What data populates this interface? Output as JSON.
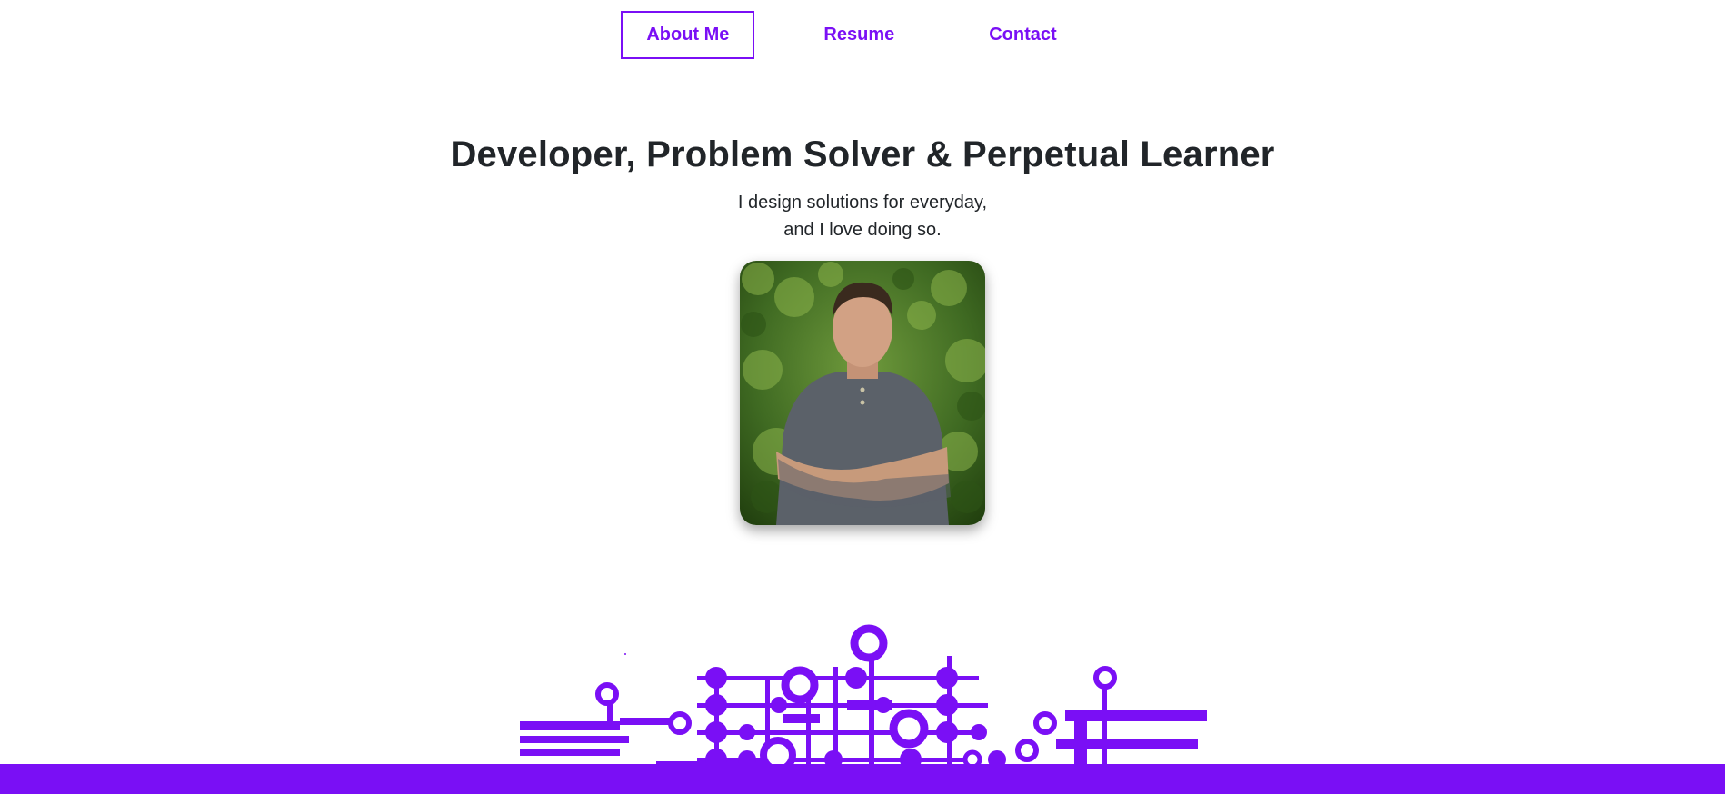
{
  "nav": {
    "items": [
      {
        "label": "About Me",
        "active": true
      },
      {
        "label": "Resume",
        "active": false
      },
      {
        "label": "Contact",
        "active": false
      }
    ]
  },
  "hero": {
    "title": "Developer, Problem Solver & Perpetual Learner",
    "tagline_line1": "I design solutions for everyday,",
    "tagline_line2": "and I love doing so."
  },
  "colors": {
    "accent": "#7a0ff5",
    "text": "#212529",
    "background": "#ffffff"
  },
  "icons": {
    "portrait": "profile-photo",
    "decoration": "circuit-board-illustration"
  }
}
